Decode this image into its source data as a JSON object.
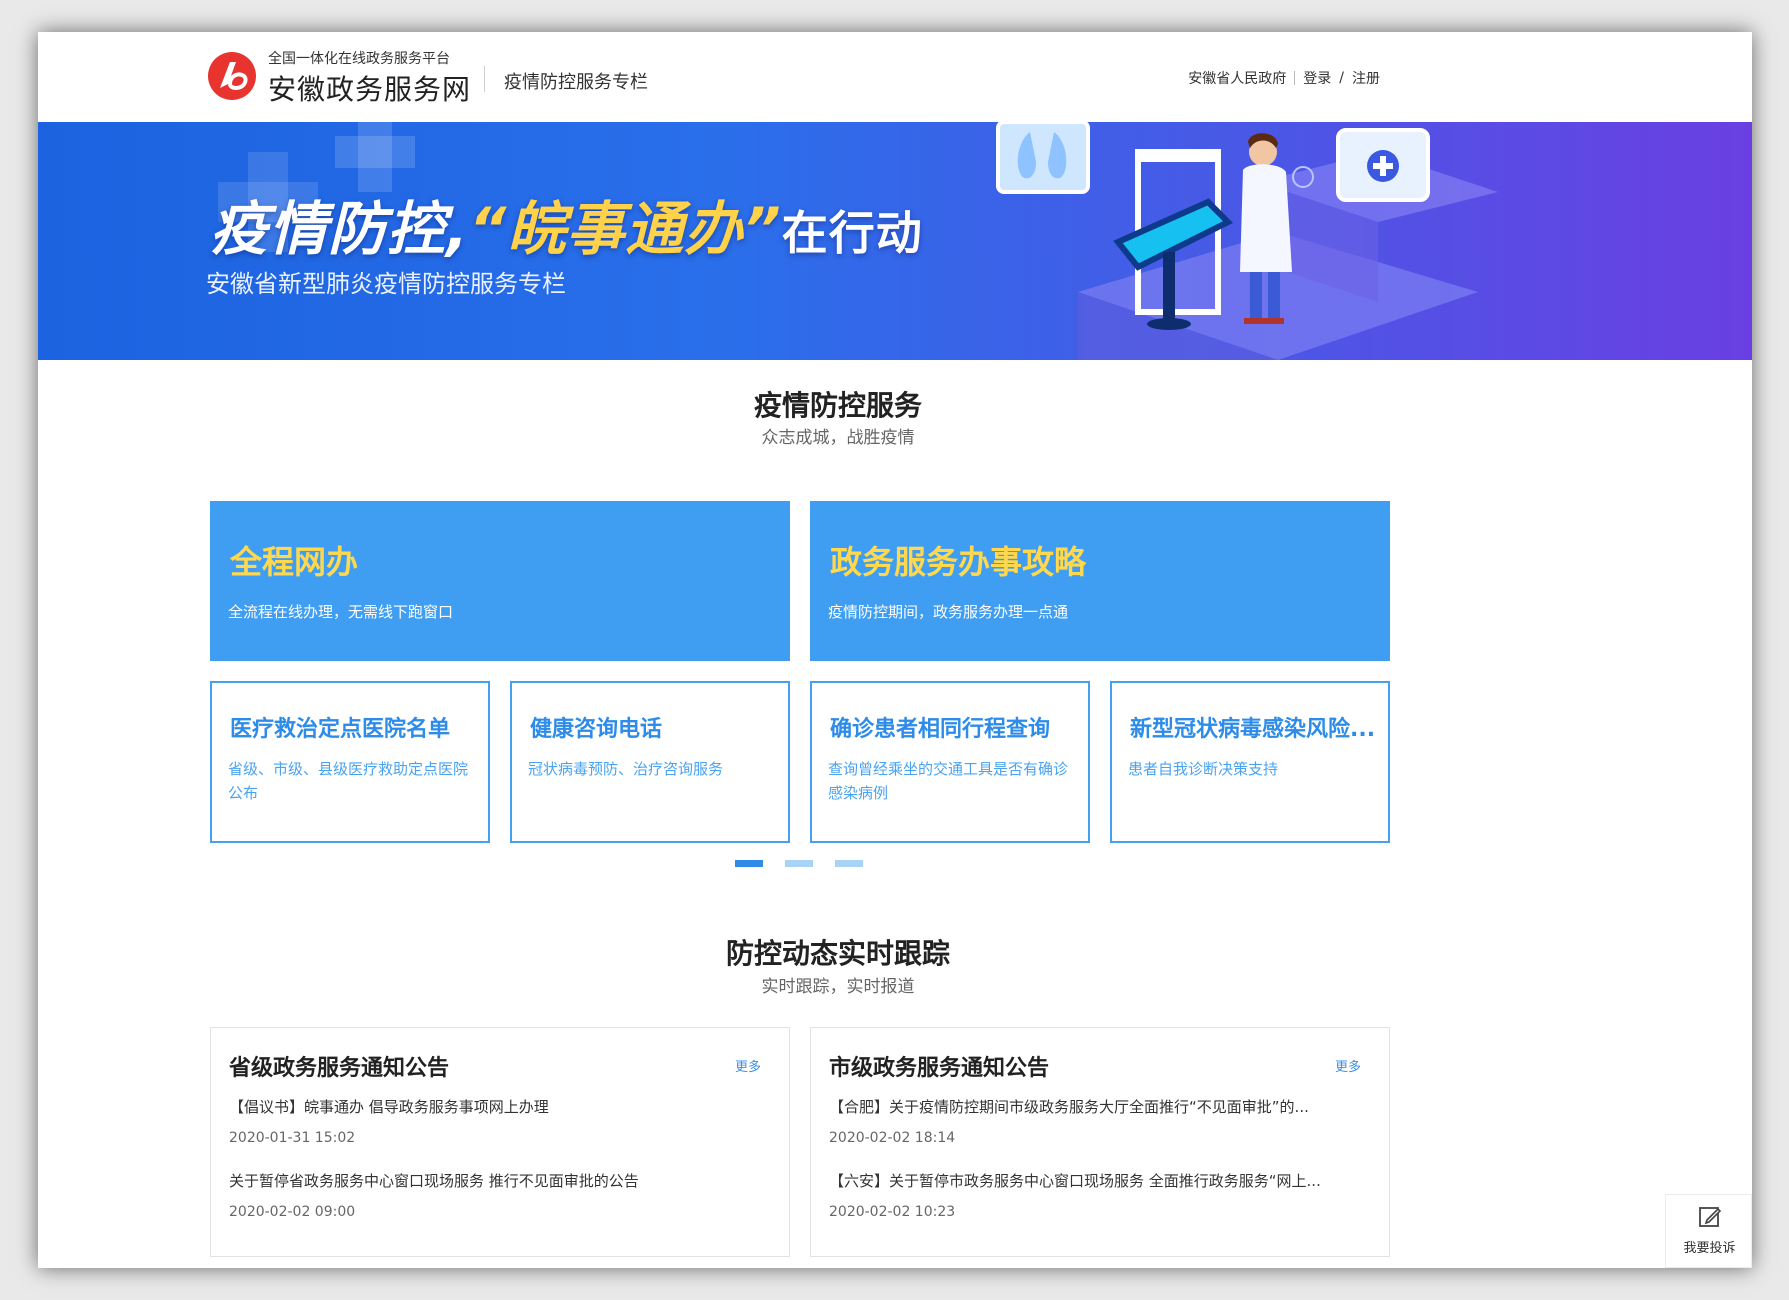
{
  "header": {
    "platform_subtitle": "全国一体化在线政务服务平台",
    "site_name": "安徽政务服务网",
    "column_title": "疫情防控服务专栏",
    "links": {
      "gov": "安徽省人民政府",
      "login": "登录",
      "slash": "/",
      "register": "注册"
    }
  },
  "banner": {
    "title_part1": "疫情防控,",
    "title_highlight": "“皖事通办”",
    "title_part2": "在行动",
    "subtitle": "安徽省新型肺炎疫情防控服务专栏"
  },
  "services": {
    "title": "疫情防控服务",
    "subtitle": "众志成城，战胜疫情",
    "big_cards": [
      {
        "title": "全程网办",
        "desc": "全流程在线办理，无需线下跑窗口"
      },
      {
        "title": "政务服务办事攻略",
        "desc": "疫情防控期间，政务服务办理一点通"
      }
    ],
    "small_cards": [
      {
        "title": "医疗救治定点医院名单",
        "desc": "省级、市级、县级医疗救助定点医院公布"
      },
      {
        "title": "健康咨询电话",
        "desc": "冠状病毒预防、治疗咨询服务"
      },
      {
        "title": "确诊患者相同行程查询",
        "desc": "查询曾经乘坐的交通工具是否有确诊感染病例"
      },
      {
        "title": "新型冠状病毒感染风险...",
        "desc": "患者自我诊断决策支持"
      }
    ],
    "pager": {
      "active_index": 0,
      "count": 3
    }
  },
  "tracking": {
    "title": "防控动态实时跟踪",
    "subtitle": "实时跟踪，实时报道",
    "panels": [
      {
        "title": "省级政务服务通知公告",
        "more": "更多",
        "items": [
          {
            "text": "【倡议书】皖事通办 倡导政务服务事项网上办理",
            "date": "2020-01-31 15:02"
          },
          {
            "text": "关于暂停省政务服务中心窗口现场服务 推行不见面审批的公告",
            "date": "2020-02-02 09:00"
          }
        ]
      },
      {
        "title": "市级政务服务通知公告",
        "more": "更多",
        "items": [
          {
            "text": "【合肥】关于疫情防控期间市级政务服务大厅全面推行“不见面审批”的...",
            "date": "2020-02-02 18:14"
          },
          {
            "text": "【六安】关于暂停市政务服务中心窗口现场服务 全面推行政务服务“网上...",
            "date": "2020-02-02 10:23"
          }
        ]
      }
    ]
  },
  "complaint": {
    "label": "我要投诉"
  },
  "colors": {
    "accent_blue": "#3f9ef2",
    "title_yellow": "#ffd84d",
    "outline_blue": "#45a0ef",
    "logo_red": "#e8342f"
  }
}
